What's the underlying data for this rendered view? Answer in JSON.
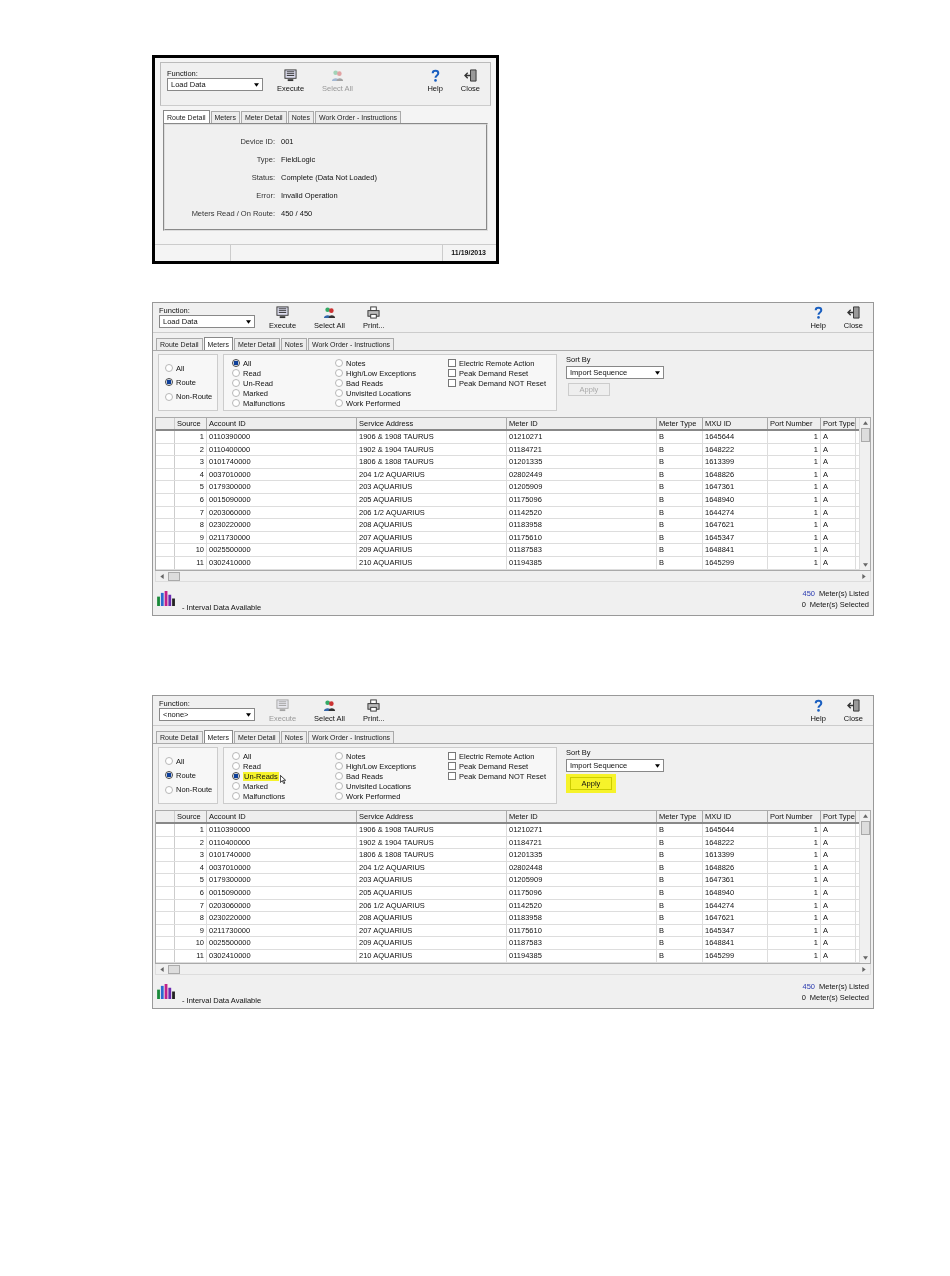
{
  "screens": [
    {
      "kind": "detail",
      "function": {
        "label": "Function:",
        "value": "Load Data"
      },
      "tools": [
        {
          "kind": "execute",
          "label": "Execute",
          "disabled": false
        },
        {
          "kind": "select_all",
          "label": "Select All",
          "disabled": true
        }
      ],
      "right_tools": [
        {
          "kind": "help",
          "label": "Help",
          "disabled": false
        },
        {
          "kind": "close",
          "label": "Close",
          "disabled": false
        }
      ],
      "tabs": [
        {
          "label": "Route Detail",
          "selected": true
        },
        {
          "label": "Meters",
          "selected": false
        },
        {
          "label": "Meter Detail",
          "selected": false
        },
        {
          "label": "Notes",
          "selected": false
        },
        {
          "label": "Work Order - Instructions",
          "selected": false
        }
      ],
      "fields": [
        {
          "label": "Device ID:",
          "value": "001"
        },
        {
          "label": "Type:",
          "value": "FieldLogic"
        },
        {
          "label": "Status:",
          "value": "Complete   (Data Not Loaded)"
        },
        {
          "label": "Error:",
          "value": "Invalid Operation"
        },
        {
          "label": "Meters Read / On Route:",
          "value": "450 / 450"
        }
      ],
      "status_bar": {
        "date": "11/19/2013"
      }
    },
    {
      "kind": "meters",
      "function": {
        "label": "Function:",
        "value": "Load Data"
      },
      "tools": [
        {
          "kind": "execute",
          "label": "Execute",
          "disabled": false
        },
        {
          "kind": "select_all",
          "label": "Select All",
          "disabled": false
        },
        {
          "kind": "print",
          "label": "Print...",
          "disabled": false
        }
      ],
      "right_tools": [
        {
          "kind": "help",
          "label": "Help",
          "disabled": false
        },
        {
          "kind": "close",
          "label": "Close",
          "disabled": false
        }
      ],
      "tabs": [
        {
          "label": "Route Detail",
          "selected": false
        },
        {
          "label": "Meters",
          "selected": true
        },
        {
          "label": "Meter Detail",
          "selected": false
        },
        {
          "label": "Notes",
          "selected": false
        },
        {
          "label": "Work Order - Instructions",
          "selected": false
        }
      ],
      "source_filter": [
        {
          "label": "All",
          "selected": false
        },
        {
          "label": "Route",
          "selected": true
        },
        {
          "label": "Non-Route",
          "selected": false
        }
      ],
      "read_filter": [
        {
          "label": "All",
          "selected": true,
          "highlighted": false
        },
        {
          "label": "Read",
          "selected": false,
          "highlighted": false
        },
        {
          "label": "Un-Read",
          "selected": false,
          "highlighted": false
        },
        {
          "label": "Marked",
          "selected": false,
          "highlighted": false
        },
        {
          "label": "Malfunctions",
          "selected": false,
          "highlighted": false
        },
        {
          "label": "Notes",
          "selected": false,
          "highlighted": false
        },
        {
          "label": "High/Low Exceptions",
          "selected": false,
          "highlighted": false
        },
        {
          "label": "Bad Reads",
          "selected": false,
          "highlighted": false
        },
        {
          "label": "Unvisited Locations",
          "selected": false,
          "highlighted": false
        },
        {
          "label": "Work Performed",
          "selected": false,
          "highlighted": false
        }
      ],
      "options": [
        {
          "label": "Electric Remote Action",
          "checked": false
        },
        {
          "label": "Peak Demand Reset",
          "checked": false
        },
        {
          "label": "Peak Demand NOT Reset",
          "checked": false
        }
      ],
      "sort": {
        "label": "Sort By",
        "value": "Import Sequence"
      },
      "apply": {
        "label": "Apply",
        "disabled": true,
        "highlighted": false
      },
      "columns": [
        "Source",
        "Account ID",
        "Service Address",
        "Meter ID",
        "Meter Type",
        "MXU ID",
        "Port Number",
        "Port Type"
      ],
      "rows": [
        [
          "1",
          "0110390000",
          "1906 & 1908 TAURUS",
          "01210271",
          "B",
          "1645644",
          "1",
          "A"
        ],
        [
          "2",
          "0110400000",
          "1902 & 1904 TAURUS",
          "01184721",
          "B",
          "1648222",
          "1",
          "A"
        ],
        [
          "3",
          "0101740000",
          "1806 & 1808 TAURUS",
          "01201335",
          "B",
          "1613399",
          "1",
          "A"
        ],
        [
          "4",
          "0037010000",
          "204 1/2 AQUARIUS",
          "02802449",
          "B",
          "1648826",
          "1",
          "A"
        ],
        [
          "5",
          "0179300000",
          "203 AQUARIUS",
          "01205909",
          "B",
          "1647361",
          "1",
          "A"
        ],
        [
          "6",
          "0015090000",
          "205 AQUARIUS",
          "01175096",
          "B",
          "1648940",
          "1",
          "A"
        ],
        [
          "7",
          "0203060000",
          "206 1/2 AQUARIUS",
          "01142520",
          "B",
          "1644274",
          "1",
          "A"
        ],
        [
          "8",
          "0230220000",
          "208 AQUARIUS",
          "01183958",
          "B",
          "1647621",
          "1",
          "A"
        ],
        [
          "9",
          "0211730000",
          "207 AQUARIUS",
          "01175610",
          "B",
          "1645347",
          "1",
          "A"
        ],
        [
          "10",
          "0025500000",
          "209 AQUARIUS",
          "01187583",
          "B",
          "1648841",
          "1",
          "A"
        ],
        [
          "11",
          "0302410000",
          "210 AQUARIUS",
          "01194385",
          "B",
          "1645299",
          "1",
          "A"
        ]
      ],
      "legend": "- Interval Data Available",
      "counts": [
        {
          "value": "450",
          "label": "Meter(s) Listed"
        },
        {
          "value": "0",
          "label": "Meter(s) Selected"
        }
      ]
    },
    {
      "kind": "meters",
      "function": {
        "label": "Function:",
        "value": "<none>"
      },
      "tools": [
        {
          "kind": "execute",
          "label": "Execute",
          "disabled": true
        },
        {
          "kind": "select_all",
          "label": "Select All",
          "disabled": false
        },
        {
          "kind": "print",
          "label": "Print...",
          "disabled": false
        }
      ],
      "right_tools": [
        {
          "kind": "help",
          "label": "Help",
          "disabled": false
        },
        {
          "kind": "close",
          "label": "Close",
          "disabled": false
        }
      ],
      "tabs": [
        {
          "label": "Route Detail",
          "selected": false
        },
        {
          "label": "Meters",
          "selected": true
        },
        {
          "label": "Meter Detail",
          "selected": false
        },
        {
          "label": "Notes",
          "selected": false
        },
        {
          "label": "Work Order - Instructions",
          "selected": false
        }
      ],
      "source_filter": [
        {
          "label": "All",
          "selected": false
        },
        {
          "label": "Route",
          "selected": true
        },
        {
          "label": "Non-Route",
          "selected": false
        }
      ],
      "read_filter": [
        {
          "label": "All",
          "selected": false,
          "highlighted": false
        },
        {
          "label": "Read",
          "selected": false,
          "highlighted": false
        },
        {
          "label": "Un-Reads",
          "selected": true,
          "highlighted": true
        },
        {
          "label": "Marked",
          "selected": false,
          "highlighted": false
        },
        {
          "label": "Malfunctions",
          "selected": false,
          "highlighted": false
        },
        {
          "label": "Notes",
          "selected": false,
          "highlighted": false
        },
        {
          "label": "High/Low Exceptions",
          "selected": false,
          "highlighted": false
        },
        {
          "label": "Bad Reads",
          "selected": false,
          "highlighted": false
        },
        {
          "label": "Unvisited Locations",
          "selected": false,
          "highlighted": false
        },
        {
          "label": "Work Performed",
          "selected": false,
          "highlighted": false
        }
      ],
      "options": [
        {
          "label": "Electric Remote Action",
          "checked": false
        },
        {
          "label": "Peak Demand Reset",
          "checked": false
        },
        {
          "label": "Peak Demand NOT Reset",
          "checked": false
        }
      ],
      "sort": {
        "label": "Sort By",
        "value": "Import Sequence"
      },
      "apply": {
        "label": "Apply",
        "disabled": false,
        "highlighted": true
      },
      "columns": [
        "Source",
        "Account ID",
        "Service Address",
        "Meter ID",
        "Meter Type",
        "MXU ID",
        "Port Number",
        "Port Type"
      ],
      "rows": [
        [
          "1",
          "0110390000",
          "1906 & 1908 TAURUS",
          "01210271",
          "B",
          "1645644",
          "1",
          "A"
        ],
        [
          "2",
          "0110400000",
          "1902 & 1904 TAURUS",
          "01184721",
          "B",
          "1648222",
          "1",
          "A"
        ],
        [
          "3",
          "0101740000",
          "1806 & 1808 TAURUS",
          "01201335",
          "B",
          "1613399",
          "1",
          "A"
        ],
        [
          "4",
          "0037010000",
          "204 1/2 AQUARIUS",
          "02802448",
          "B",
          "1648826",
          "1",
          "A"
        ],
        [
          "5",
          "0179300000",
          "203 AQUARIUS",
          "01205909",
          "B",
          "1647361",
          "1",
          "A"
        ],
        [
          "6",
          "0015090000",
          "205 AQUARIUS",
          "01175096",
          "B",
          "1648940",
          "1",
          "A"
        ],
        [
          "7",
          "0203060000",
          "206 1/2 AQUARIUS",
          "01142520",
          "B",
          "1644274",
          "1",
          "A"
        ],
        [
          "8",
          "0230220000",
          "208 AQUARIUS",
          "01183958",
          "B",
          "1647621",
          "1",
          "A"
        ],
        [
          "9",
          "0211730000",
          "207 AQUARIUS",
          "01175610",
          "B",
          "1645347",
          "1",
          "A"
        ],
        [
          "10",
          "0025500000",
          "209 AQUARIUS",
          "01187583",
          "B",
          "1648841",
          "1",
          "A"
        ],
        [
          "11",
          "0302410000",
          "210 AQUARIUS",
          "01194385",
          "B",
          "1645299",
          "1",
          "A"
        ]
      ],
      "legend": "- Interval Data Available",
      "counts": [
        {
          "value": "450",
          "label": "Meter(s) Listed"
        },
        {
          "value": "0",
          "label": "Meter(s) Selected"
        }
      ]
    }
  ]
}
